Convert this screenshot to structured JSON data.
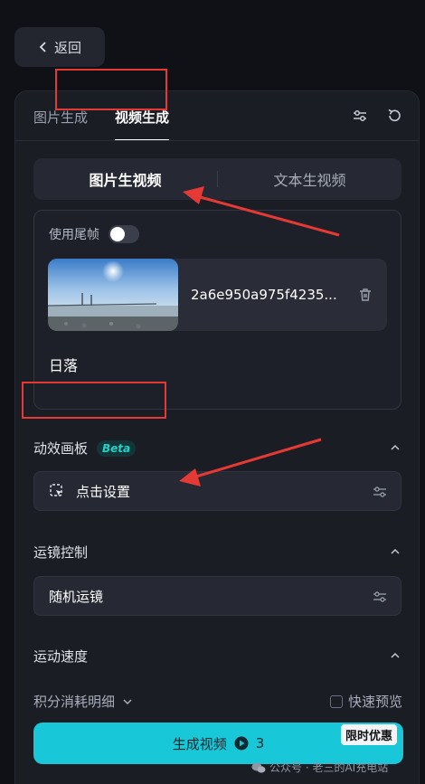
{
  "back": {
    "label": "返回"
  },
  "tabs": [
    {
      "label": "图片生成",
      "active": false
    },
    {
      "label": "视频生成",
      "active": true
    }
  ],
  "mode_switch": [
    {
      "label": "图片生视频",
      "active": true
    },
    {
      "label": "文本生视频",
      "active": false
    }
  ],
  "source_card": {
    "tail_frame_label": "使用尾帧",
    "tail_frame_enabled": false,
    "image_filename": "2a6e950a975f4235...",
    "prompt": "日落"
  },
  "motion_panel": {
    "title": "动效画板",
    "badge": "Beta",
    "button_label": "点击设置"
  },
  "camera_control": {
    "title": "运镜控制",
    "value": "随机运镜"
  },
  "motion_speed": {
    "title": "运动速度"
  },
  "footer": {
    "credit_details": "积分消耗明细",
    "fast_preview": "快速预览",
    "generate_label": "生成视频",
    "generate_cost": "3",
    "promo": "限时优惠"
  },
  "watermark": "公众号 · 老三的AI充电站",
  "colors": {
    "accent": "#18c8d8",
    "annotation_red": "#e53935",
    "badge_text": "#22d3c5"
  }
}
